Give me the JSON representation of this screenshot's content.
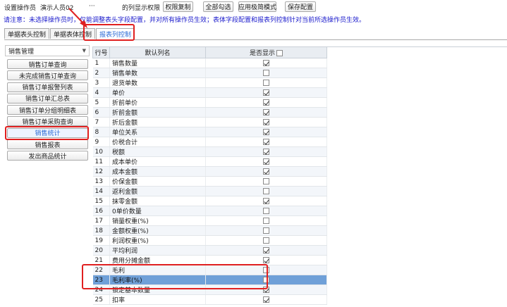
{
  "toolbar": {
    "operator_label": "设置操作员",
    "operator_value": "演示人员02",
    "ellipsis": "···",
    "column_perm_label": "的列显示权限",
    "copy_perm_btn": "权限复制",
    "select_all_btn": "全部勾选",
    "simple_mode_btn": "应用极简模式",
    "save_btn": "保存配置"
  },
  "notice": "请注意：未选择操作员时，仅能调整表头字段配置，并对所有操作员生效；表体字段配置和报表列控制针对当前所选操作员生效。",
  "tabs": [
    {
      "label": "单据表头控制"
    },
    {
      "label": "单据表体控制"
    },
    {
      "label": "报表列控制"
    }
  ],
  "left": {
    "dropdown": "销售管理",
    "items": [
      "销售订单查询",
      "未完成销售订单查询",
      "销售订单报警列表",
      "销售订单汇总表",
      "销售订单分组明细表",
      "销售订单采购查询",
      "销售统计",
      "销售报表",
      "发出商品统计"
    ],
    "selected_index": 6
  },
  "grid": {
    "headers": {
      "num": "行号",
      "name": "默认列名",
      "show": "是否显示"
    },
    "rows": [
      {
        "n": "1",
        "name": "销售数量",
        "on": true
      },
      {
        "n": "2",
        "name": "销售单数",
        "on": false
      },
      {
        "n": "3",
        "name": "退货单数",
        "on": false
      },
      {
        "n": "4",
        "name": "单价",
        "on": true
      },
      {
        "n": "5",
        "name": "折前单价",
        "on": true
      },
      {
        "n": "6",
        "name": "折前金额",
        "on": true
      },
      {
        "n": "7",
        "name": "折后金额",
        "on": true
      },
      {
        "n": "8",
        "name": "单位关系",
        "on": true
      },
      {
        "n": "9",
        "name": "价税合计",
        "on": true
      },
      {
        "n": "10",
        "name": "税额",
        "on": true
      },
      {
        "n": "11",
        "name": "成本单价",
        "on": true
      },
      {
        "n": "12",
        "name": "成本金额",
        "on": true
      },
      {
        "n": "13",
        "name": "价保金额",
        "on": false
      },
      {
        "n": "14",
        "name": "返利金额",
        "on": false
      },
      {
        "n": "15",
        "name": "抹零金额",
        "on": true
      },
      {
        "n": "16",
        "name": "0单价数量",
        "on": false
      },
      {
        "n": "17",
        "name": "销量权重(%)",
        "on": false
      },
      {
        "n": "18",
        "name": "金额权重(%)",
        "on": false
      },
      {
        "n": "19",
        "name": "利润权重(%)",
        "on": false
      },
      {
        "n": "20",
        "name": "平均利润",
        "on": true
      },
      {
        "n": "21",
        "name": "费用分摊金额",
        "on": true
      },
      {
        "n": "22",
        "name": "毛利",
        "on": false
      },
      {
        "n": "23",
        "name": "毛利率(%)",
        "on": false
      },
      {
        "n": "24",
        "name": "锁定基本数量",
        "on": true
      },
      {
        "n": "25",
        "name": "扣率",
        "on": true
      }
    ],
    "selected_row": 22
  }
}
